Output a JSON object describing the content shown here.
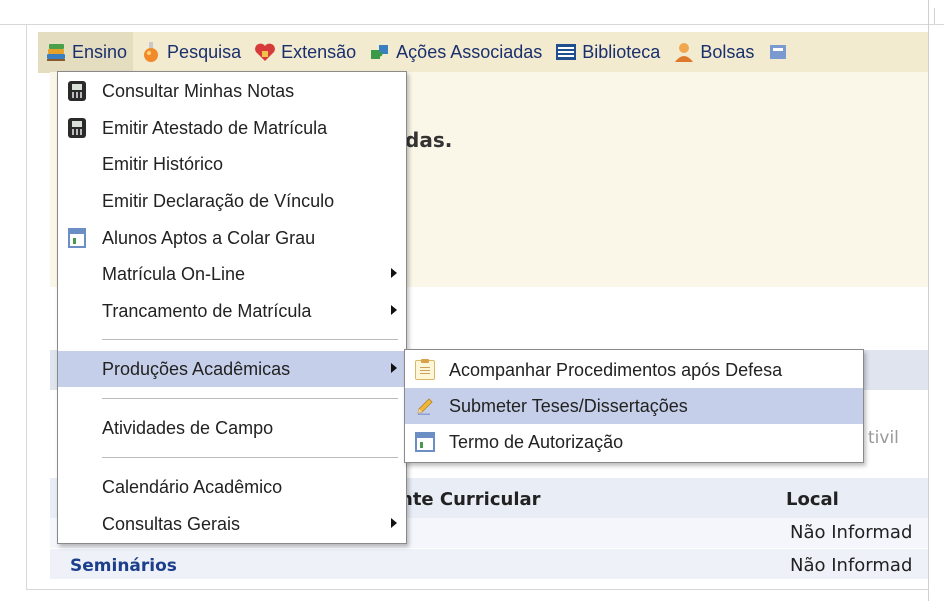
{
  "menubar": {
    "items": [
      {
        "label": "Ensino",
        "icon": "books-icon"
      },
      {
        "label": "Pesquisa",
        "icon": "flask-icon"
      },
      {
        "label": "Extensão",
        "icon": "heart-icon"
      },
      {
        "label": "Ações Associadas",
        "icon": "puzzle-icon"
      },
      {
        "label": "Biblioteca",
        "icon": "library-icon"
      },
      {
        "label": "Bolsas",
        "icon": "person-icon"
      }
    ]
  },
  "background": {
    "welcome_fragment": "das.",
    "grey_fragment": "tivil",
    "table": {
      "col_component": "nte Curricular",
      "col_local": "Local",
      "rows": [
        {
          "component": "",
          "local": "Não Informad"
        },
        {
          "component": "Seminários",
          "local": "Não Informad"
        }
      ]
    }
  },
  "dropdown": {
    "items": [
      {
        "label": "Consultar Minhas Notas",
        "icon": "phone-icon"
      },
      {
        "label": "Emitir Atestado de Matrícula",
        "icon": "phone-icon"
      },
      {
        "label": "Emitir Histórico",
        "icon": ""
      },
      {
        "label": "Emitir Declaração de Vínculo",
        "icon": ""
      },
      {
        "label": "Alunos Aptos a Colar Grau",
        "icon": "window-icon"
      },
      {
        "label": "Matrícula On-Line",
        "icon": "",
        "submenu": true
      },
      {
        "label": "Trancamento de Matrícula",
        "icon": "",
        "submenu": true
      },
      {
        "label": "Produções Acadêmicas",
        "icon": "",
        "submenu": true,
        "highlighted": true
      },
      {
        "label": "Atividades de Campo",
        "icon": ""
      },
      {
        "label": "Calendário Acadêmico",
        "icon": ""
      },
      {
        "label": "Consultas Gerais",
        "icon": "",
        "submenu": true
      }
    ]
  },
  "submenu": {
    "items": [
      {
        "label": "Acompanhar Procedimentos após Defesa",
        "icon": "clipboard-icon"
      },
      {
        "label": "Submeter Teses/Dissertações",
        "icon": "pencil-icon",
        "highlighted": true
      },
      {
        "label": "Termo de Autorização",
        "icon": "window-icon"
      }
    ]
  },
  "colors": {
    "menubar_bg": "#f2ebcf",
    "menu_text": "#1a2f6e",
    "highlight": "#c6cfe9",
    "link": "#1c3f8c"
  }
}
